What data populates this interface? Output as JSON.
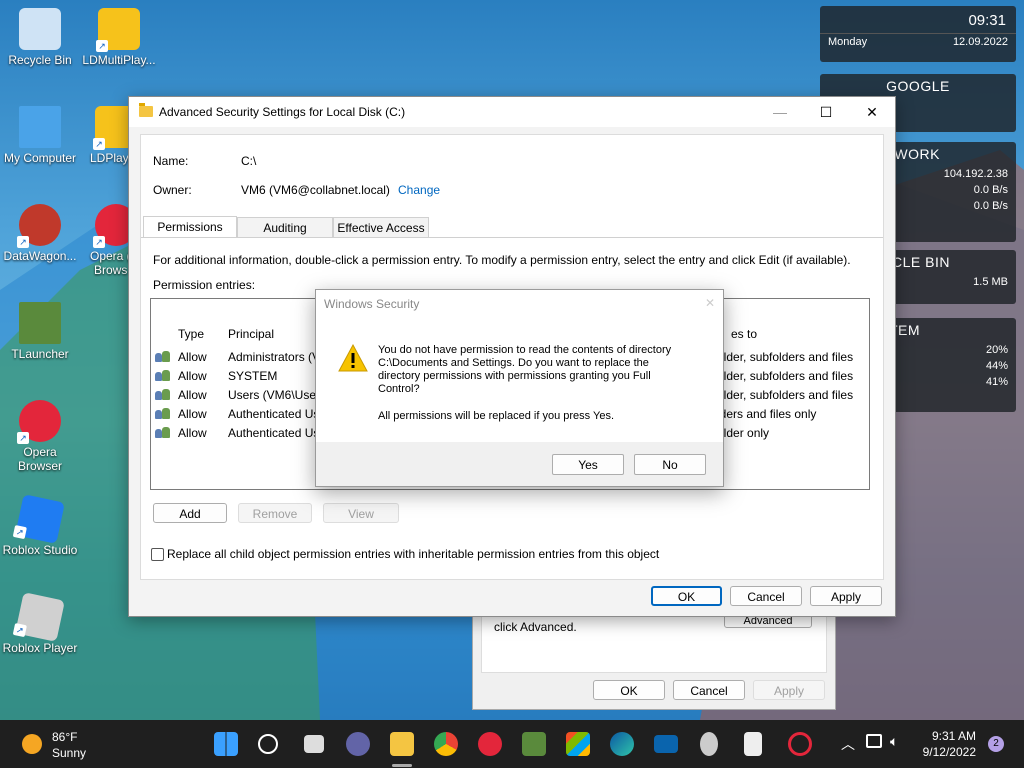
{
  "desktop": {
    "icons": [
      {
        "label": "Recycle Bin",
        "color": "#cfe3f5"
      },
      {
        "label": "LDMultiPlay...",
        "color": "#f6c21b"
      },
      {
        "label": "My Computer",
        "color": "#4aa3e8"
      },
      {
        "label": "LDPlaye",
        "color": "#f6c21b"
      },
      {
        "label": "DataWagon...",
        "color": "#c0392b"
      },
      {
        "label": "Opera (",
        "color": "#e3263b"
      },
      {
        "label": "Brows",
        "color": "#e3263b"
      },
      {
        "label": "TLauncher",
        "color": "#5a8a3c"
      },
      {
        "label": "Opera Browser",
        "color": "#e3263b"
      },
      {
        "label": "Roblox Studio",
        "color": "#1f7cf2"
      },
      {
        "label": "Roblox Player",
        "color": "#d0d0d0"
      }
    ]
  },
  "widgets": {
    "clock": {
      "time": "09:31",
      "day": "Monday",
      "date": "12.09.2022"
    },
    "google": {
      "title": "GOOGLE"
    },
    "network": {
      "title": "ETWORK",
      "ip": "104.192.2.38",
      "down": "0.0 B/s",
      "up": "0.0 B/s"
    },
    "recycle": {
      "title": "YCLE BIN",
      "size": "1.5 MB"
    },
    "system": {
      "title": "YSTEM",
      "cpu": "20%",
      "ram": "44%",
      "disk": "41%"
    }
  },
  "bg_dialog": {
    "text": "click Advanced.",
    "advanced_button": "Advanced",
    "ok": "OK",
    "cancel": "Cancel",
    "apply": "Apply"
  },
  "main_dialog": {
    "title": "Advanced Security Settings for Local Disk (C:)",
    "name_label": "Name:",
    "name_value": "C:\\",
    "owner_label": "Owner:",
    "owner_value": "VM6 (VM6@collabnet.local)",
    "change_link": "Change",
    "tabs": [
      "Permissions",
      "Auditing",
      "Effective Access"
    ],
    "info_text": "For additional information, double-click a permission entry. To modify a permission entry, select the entry and click Edit (if available).",
    "entries_label": "Permission entries:",
    "columns": {
      "type": "Type",
      "principal": "Principal",
      "applies": "es to"
    },
    "rows": [
      {
        "type": "Allow",
        "principal": "Administrators (V",
        "applies": "older, subfolders and files"
      },
      {
        "type": "Allow",
        "principal": "SYSTEM",
        "applies": "older, subfolders and files"
      },
      {
        "type": "Allow",
        "principal": "Users (VM6\\User",
        "applies": "older, subfolders and files"
      },
      {
        "type": "Allow",
        "principal": "Authenticated Us",
        "applies": "lders and files only"
      },
      {
        "type": "Allow",
        "principal": "Authenticated Us",
        "applies": "older only"
      }
    ],
    "add": "Add",
    "remove": "Remove",
    "view": "View",
    "replace_checkbox": "Replace all child object permission entries with inheritable permission entries from this object",
    "ok": "OK",
    "cancel": "Cancel",
    "apply": "Apply"
  },
  "modal": {
    "title": "Windows Security",
    "message_1": "You do not have permission to read the contents of directory",
    "message_2": "C:\\Documents and Settings. Do you want to replace the",
    "message_3": "directory permissions with permissions granting you Full",
    "message_4": "Control?",
    "message_5": "All permissions will be replaced if you press Yes.",
    "yes": "Yes",
    "no": "No"
  },
  "taskbar": {
    "weather_temp": "86°F",
    "weather_desc": "Sunny",
    "time": "9:31 AM",
    "date": "9/12/2022",
    "notifications": "2"
  }
}
